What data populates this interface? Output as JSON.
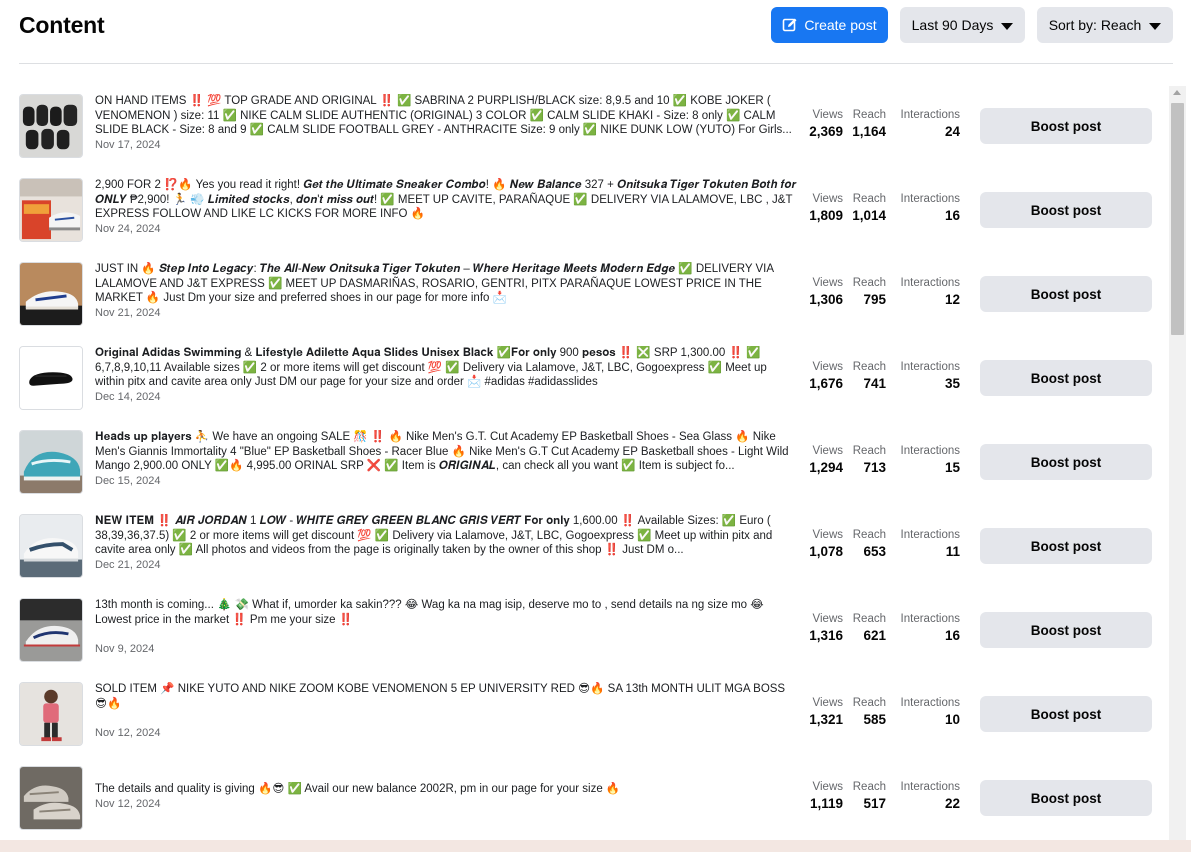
{
  "header": {
    "title": "Content",
    "create_label": "Create post",
    "days_label": "Last 90 Days",
    "sort_label": "Sort by: Reach"
  },
  "labels": {
    "views": "Views",
    "reach": "Reach",
    "interactions": "Interactions",
    "boost": "Boost post"
  },
  "colors": {
    "primary": "#1877f2",
    "button_gray": "#e4e6eb"
  },
  "posts": [
    {
      "text": "ON HAND ITEMS ‼️ 💯 TOP GRADE AND ORIGINAL ‼️ ✅ SABRINA 2 PURPLISH/BLACK size: 8,9.5 and 10 ✅ KOBE JOKER ( VENOMENON ) size: 11 ✅ NIKE CALM SLIDE AUTHENTIC (ORIGINAL) 3 COLOR ✅ CALM SLIDE KHAKI - Size: 8 only ✅ CALM SLIDE BLACK - Size: 8 and 9 ✅ CALM SLIDE FOOTBALL GREY - ANTHRACITE Size: 9 only ✅ NIKE DUNK LOW (YUTO) For Girls...",
      "date": "Nov 17, 2024",
      "views": "2,369",
      "reach": "1,164",
      "interactions": "24"
    },
    {
      "text": "2,900 FOR 2 ⁉️🔥 Yes you read it right! 𝑮𝒆𝒕 𝒕𝒉𝒆 𝑼𝒍𝒕𝒊𝒎𝒂𝒕𝒆 𝑺𝒏𝒆𝒂𝒌𝒆𝒓 𝑪𝒐𝒎𝒃𝒐! 🔥 𝑵𝒆𝒘 𝑩𝒂𝒍𝒂𝒏𝒄𝒆 327 + 𝑶𝒏𝒊𝒕𝒔𝒖𝒌𝒂 𝑻𝒊𝒈𝒆𝒓 𝑻𝒐𝒌𝒖𝒕𝒆𝒏 𝑩𝒐𝒕𝒉 𝒇𝒐𝒓 𝑶𝑵𝑳𝒀 ₱2,900! 🏃 💨 𝑳𝒊𝒎𝒊𝒕𝒆𝒅 𝒔𝒕𝒐𝒄𝒌𝒔, 𝒅𝒐𝒏'𝒕 𝒎𝒊𝒔𝒔 𝒐𝒖𝒕! ✅ MEET UP CAVITE, PARAÑAQUE ✅ DELIVERY VIA LALAMOVE, LBC , J&T EXPRESS FOLLOW AND LIKE LC KICKS FOR MORE INFO 🔥",
      "date": "Nov 24, 2024",
      "views": "1,809",
      "reach": "1,014",
      "interactions": "16"
    },
    {
      "text": "JUST IN 🔥 𝑺𝒕𝒆𝒑 𝑰𝒏𝒕𝒐 𝑳𝒆𝒈𝒂𝒄𝒚: 𝑻𝒉𝒆 𝑨𝒍𝒍-𝑵𝒆𝒘 𝑶𝒏𝒊𝒕𝒔𝒖𝒌𝒂 𝑻𝒊𝒈𝒆𝒓 𝑻𝒐𝒌𝒖𝒕𝒆𝒏 – 𝑾𝒉𝒆𝒓𝒆 𝑯𝒆𝒓𝒊𝒕𝒂𝒈𝒆 𝑴𝒆𝒆𝒕𝒔 𝑴𝒐𝒅𝒆𝒓𝒏 𝑬𝒅𝒈𝒆 ✅ DELIVERY VIA LALAMOVE AND J&T EXPRESS ✅ MEET UP DASMARIÑAS, ROSARIO, GENTRI, PITX PARAÑAQUE LOWEST PRICE IN THE MARKET 🔥 Just Dm your size and preferred shoes in our page for more info 📩",
      "date": "Nov 21, 2024",
      "views": "1,306",
      "reach": "795",
      "interactions": "12"
    },
    {
      "text": "𝐎𝐫𝐢𝐠𝐢𝐧𝐚𝐥 𝐀𝐝𝐢𝐝𝐚𝐬 𝐒𝐰𝐢𝐦𝐦𝐢𝐧𝐠 & 𝐋𝐢𝐟𝐞𝐬𝐭𝐲𝐥𝐞 𝐀𝐝𝐢𝐥𝐞𝐭𝐭𝐞 𝐀𝐪𝐮𝐚 𝐒𝐥𝐢𝐝𝐞𝐬 𝐔𝐧𝐢𝐬𝐞𝐱 𝐁𝐥𝐚𝐜𝐤 ✅𝐅𝐨𝐫 𝐨𝐧𝐥𝐲 900 𝐩𝐞𝐬𝐨𝐬 ‼️ ❎ SRP 1,300.00 ‼️ ✅ 6,7,8,9,10,11 Available sizes ✅ 2 or more items will get discount 💯 ✅ Delivery via Lalamove, J&T, LBC, Gogoexpress ✅ Meet up within pitx and cavite area only Just DM our page for your size and order 📩 #adidas #adidasslides",
      "date": "Dec 14, 2024",
      "views": "1,676",
      "reach": "741",
      "interactions": "35"
    },
    {
      "text": "𝐇𝐞𝐚𝐝𝐬 𝐮𝐩 𝐩𝐥𝐚𝐲𝐞𝐫𝐬 ⛹️ We have an ongoing SALE 🎊 ‼️ 🔥 Nike Men's G.T. Cut Academy EP Basketball Shoes - Sea Glass 🔥 Nike Men's Giannis Immortality 4 \"Blue\" EP Basketball Shoes - Racer Blue 🔥 Nike Men's G.T Cut Academy EP Basketball shoes - Light Wild Mango 2,900.00 ONLY ✅🔥 4,995.00 ORINAL SRP ❌ ✅ Item is 𝑶𝑹𝑰𝑮𝑰𝑵𝑨𝑳, can check all you want ✅ Item is subject fo...",
      "date": "Dec 15, 2024",
      "views": "1,294",
      "reach": "713",
      "interactions": "15"
    },
    {
      "text": "𝐍𝐄𝐖 𝐈𝐓𝐄𝐌 ‼️ 𝑨𝑰𝑹 𝑱𝑶𝑹𝑫𝑨𝑵 1 𝑳𝑶𝑾 - 𝑾𝑯𝑰𝑻𝑬 𝑮𝑹𝑬𝒀 𝑮𝑹𝑬𝑬𝑵 𝑩𝑳𝑨𝑵𝑪 𝑮𝑹𝑰𝑺 𝑽𝑬𝑹𝑻 𝐅𝐨𝐫 𝐨𝐧𝐥𝐲 1,600.00 ‼️ Available Sizes: ✅ Euro ( 38,39,36,37.5) ✅ 2 or more items will get discount 💯 ✅ Delivery via Lalamove, J&T, LBC, Gogoexpress ✅ Meet up within pitx and cavite area only ✅ All photos and videos from the page is originally taken by the owner of this shop ‼️ Just DM o...",
      "date": "Dec 21, 2024",
      "views": "1,078",
      "reach": "653",
      "interactions": "11"
    },
    {
      "text": "13th month is coming... 🎄 💸 What if, umorder ka sakin??? 😂 Wag ka na mag isip, deserve mo to , send details na ng size mo 😂 Lowest price in the market ‼️ Pm me your size ‼️",
      "date": "Nov 9, 2024",
      "views": "1,316",
      "reach": "621",
      "interactions": "16"
    },
    {
      "text": "SOLD ITEM 📌 NIKE YUTO AND NIKE ZOOM KOBE VENOMENON 5 EP UNIVERSITY RED 😎🔥 SA 13th MONTH ULIT MGA BOSS 😎🔥",
      "date": "Nov 12, 2024",
      "views": "1,321",
      "reach": "585",
      "interactions": "10"
    },
    {
      "text": "The details and quality is giving 🔥😎 ✅ Avail our new balance 2002R, pm in our page for your size 🔥",
      "date": "Nov 12, 2024",
      "views": "1,119",
      "reach": "517",
      "interactions": "22"
    }
  ]
}
